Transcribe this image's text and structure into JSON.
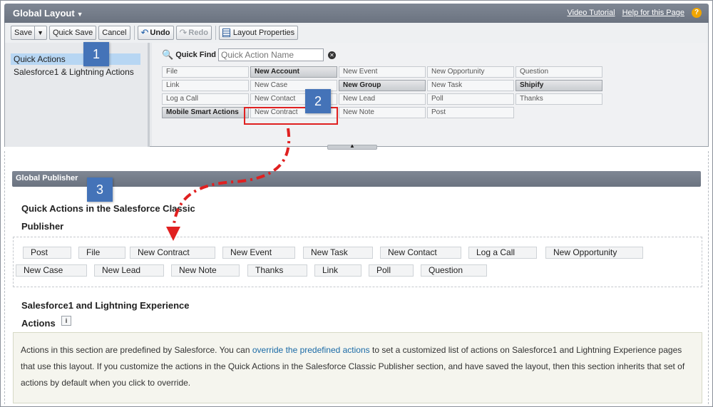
{
  "header": {
    "title": "Global Layout",
    "links": {
      "video_tutorial": "Video Tutorial",
      "help": "Help for this Page"
    },
    "help_icon": "?"
  },
  "toolbar": {
    "save": "Save",
    "quick_save": "Quick Save",
    "cancel": "Cancel",
    "undo": "Undo",
    "redo": "Redo",
    "layout_properties": "Layout Properties"
  },
  "palette": {
    "categories": [
      {
        "label": "Quick Actions"
      },
      {
        "label": "Salesforce1 & Lightning Actions"
      }
    ],
    "quick_find": {
      "label": "Quick Find",
      "placeholder": "Quick Action Name"
    },
    "grid": [
      [
        {
          "label": "File",
          "used": false
        },
        {
          "label": "New Account",
          "used": true
        },
        {
          "label": "New Event",
          "used": false
        },
        {
          "label": "New Opportunity",
          "used": false
        },
        {
          "label": "Question",
          "used": false
        }
      ],
      [
        {
          "label": "Link",
          "used": false
        },
        {
          "label": "New Case",
          "used": false
        },
        {
          "label": "New Group",
          "used": true
        },
        {
          "label": "New Task",
          "used": false
        },
        {
          "label": "Shipify",
          "used": true
        }
      ],
      [
        {
          "label": "Log a Call",
          "used": false
        },
        {
          "label": "New Contact",
          "used": false
        },
        {
          "label": "New Lead",
          "used": false
        },
        {
          "label": "Poll",
          "used": false
        },
        {
          "label": "Thanks",
          "used": false
        }
      ],
      [
        {
          "label": "Mobile Smart Actions",
          "used": true
        },
        {
          "label": "New Contract",
          "used": false
        },
        {
          "label": "New Note",
          "used": false
        },
        {
          "label": "Post",
          "used": false
        }
      ]
    ]
  },
  "canvas": {
    "section_header": "Global Publisher",
    "classic_title_line1": "Quick Actions in the Salesforce Classic",
    "classic_title_line2": "Publisher",
    "classic_actions": [
      "Post",
      "File",
      "New Contract",
      "New Event",
      "New Task",
      "New Contact",
      "Log a Call",
      "New Opportunity",
      "New Case",
      "New Lead",
      "New Note",
      "Thanks",
      "Link",
      "Poll",
      "Question"
    ],
    "sf1_title_line1": "Salesforce1 and Lightning Experience",
    "sf1_title_line2": "Actions",
    "info_icon": "i",
    "sf1_text_before": "Actions in this section are predefined by Salesforce. You can ",
    "sf1_link": "override the predefined actions",
    "sf1_text_after": " to set a customized list of actions on Salesforce1 and Lightning Experience pages that use this layout. If you customize the actions in the Quick Actions in the Salesforce Classic Publisher section, and have saved the layout, then this section inherits that set of actions by default when you click to override."
  },
  "callouts": [
    "1",
    "2",
    "3"
  ],
  "colors": {
    "header_bg": "#6b7380",
    "badge": "#4473b8",
    "highlight": "#e02020",
    "link": "#1a6aa6",
    "selected": "#b7d6f3"
  }
}
